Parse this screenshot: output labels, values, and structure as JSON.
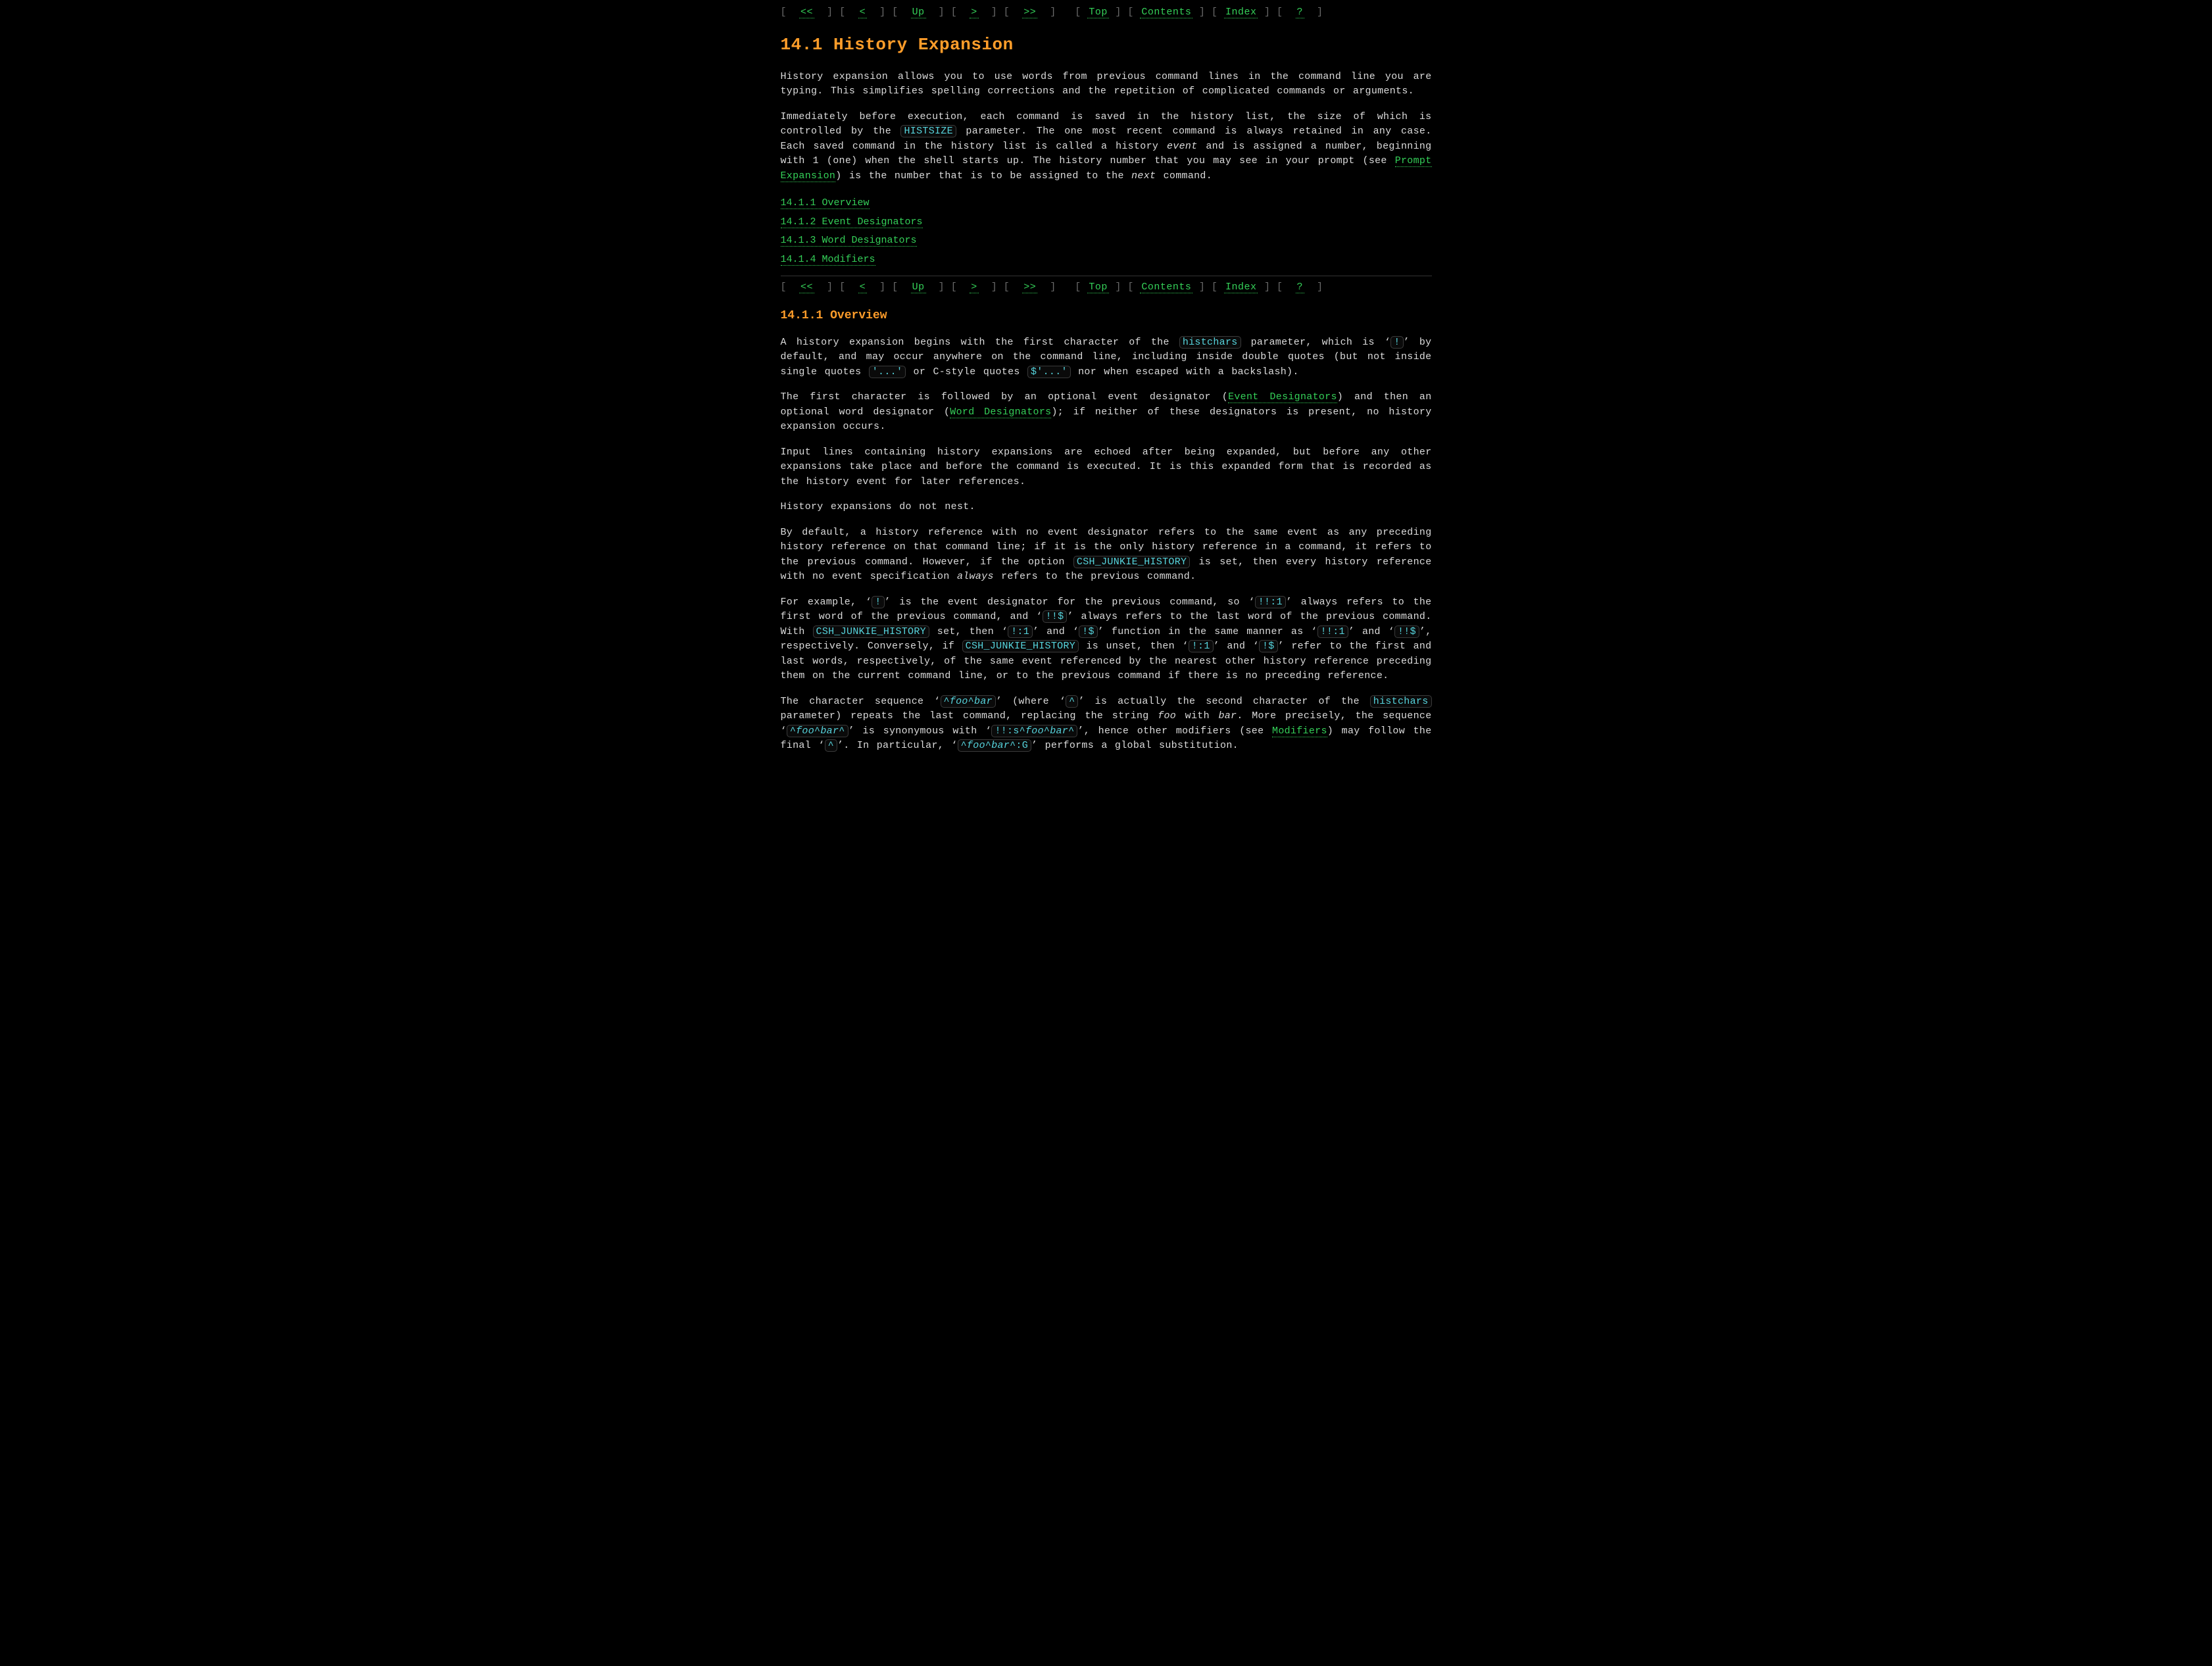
{
  "nav": {
    "first": "<<",
    "prev": "<",
    "up": "Up",
    "next": ">",
    "last": ">>",
    "top": "Top",
    "contents": "Contents",
    "index": "Index",
    "help": "?"
  },
  "section_14_1": {
    "title": "14.1 History Expansion",
    "p1_a": "History expansion allows you to use words from previous command lines in the command line you are typing. This simplifies spelling corrections and the repetition of complicated commands or arguments.",
    "p2_a": "Immediately before execution, each command is saved in the history list, the size of which is controlled by the ",
    "p2_code1": "HISTSIZE",
    "p2_b": " parameter. The one most recent command is always retained in any case. Each saved command in the history list is called a history ",
    "p2_em1": "event",
    "p2_c": " and is assigned a number, beginning with 1 (one) when the shell starts up. The history number that you may see in your prompt (see ",
    "p2_link1": "Prompt Expansion",
    "p2_d": ") is the number that is to be assigned to the ",
    "p2_em2": "next",
    "p2_e": " command."
  },
  "toc": {
    "i1": "14.1.1 Overview",
    "i2": "14.1.2 Event Designators",
    "i3": "14.1.3 Word Designators",
    "i4": "14.1.4 Modifiers"
  },
  "section_14_1_1": {
    "title": "14.1.1 Overview",
    "p1_a": "A history expansion begins with the first character of the ",
    "p1_code1": "histchars",
    "p1_b": " parameter, which is ‘",
    "p1_code2": "!",
    "p1_c": "’ by default, and may occur anywhere on the command line, including inside double quotes (but not inside single quotes ",
    "p1_code3": "'...'",
    "p1_d": " or C-style quotes ",
    "p1_code4": "$'...'",
    "p1_e": " nor when escaped with a backslash).",
    "p2_a": "The first character is followed by an optional event designator (",
    "p2_link1": "Event Designators",
    "p2_b": ") and then an optional word designator (",
    "p2_link2": "Word Designators",
    "p2_c": "); if neither of these designators is present, no history expansion occurs.",
    "p3": "Input lines containing history expansions are echoed after being expanded, but before any other expansions take place and before the command is executed. It is this expanded form that is recorded as the history event for later references.",
    "p4": "History expansions do not nest.",
    "p5_a": "By default, a history reference with no event designator refers to the same event as any preceding history reference on that command line; if it is the only history reference in a command, it refers to the previous command. However, if the option ",
    "p5_code1": "CSH_JUNKIE_HISTORY",
    "p5_b": " is set, then every history reference with no event specification ",
    "p5_em1": "always",
    "p5_c": " refers to the previous command.",
    "p6_a": "For example, ‘",
    "p6_code1": "!",
    "p6_b": "’ is the event designator for the previous command, so ‘",
    "p6_code2": "!!:1",
    "p6_c": "’ always refers to the first word of the previous command, and ‘",
    "p6_code3": "!!$",
    "p6_d": "’ always refers to the last word of the previous command. With ",
    "p6_code4": "CSH_JUNKIE_HISTORY",
    "p6_e": " set, then ‘",
    "p6_code5": "!:1",
    "p6_f": "’ and ‘",
    "p6_code6": "!$",
    "p6_g": "’ function in the same manner as ‘",
    "p6_code7": "!!:1",
    "p6_h": "’ and ‘",
    "p6_code8": "!!$",
    "p6_i": "’, respectively. Conversely, if ",
    "p6_code9": "CSH_JUNKIE_HISTORY",
    "p6_j": " is unset, then ‘",
    "p6_code10": "!:1",
    "p6_k": "’ and ‘",
    "p6_code11": "!$",
    "p6_l": "’ refer to the first and last words, respectively, of the same event referenced by the nearest other history reference preceding them on the current command line, or to the previous command if there is no preceding reference.",
    "p7_a": "The character sequence ‘",
    "p7_code1": "^",
    "p7_em1": "foo",
    "p7_code2": "^",
    "p7_em2": "bar",
    "p7_b": "’ (where ‘",
    "p7_code3": "^",
    "p7_c": "’ is actually the second character of the ",
    "p7_code4": "histchars",
    "p7_d": " parameter) repeats the last command, replacing the string ",
    "p7_em3": "foo",
    "p7_e": " with ",
    "p7_em4": "bar",
    "p7_f": ". More precisely, the sequence ‘",
    "p7_code5": "^",
    "p7_em5": "foo",
    "p7_code6": "^",
    "p7_em6": "bar",
    "p7_code7": "^",
    "p7_g": "’ is synonymous with ‘",
    "p7_code8": "!!:s",
    "p7_code9": "^",
    "p7_em7": "foo",
    "p7_code10": "^",
    "p7_em8": "bar",
    "p7_code11": "^",
    "p7_h": "’, hence other modifiers (see ",
    "p7_link1": "Modifiers",
    "p7_i": ") may follow the final ‘",
    "p7_code12": "^",
    "p7_j": "’. In particular, ‘",
    "p7_code13": "^",
    "p7_em9": "foo",
    "p7_code14": "^",
    "p7_em10": "bar",
    "p7_code15": "^:G",
    "p7_k": "’ performs a global substitution."
  }
}
